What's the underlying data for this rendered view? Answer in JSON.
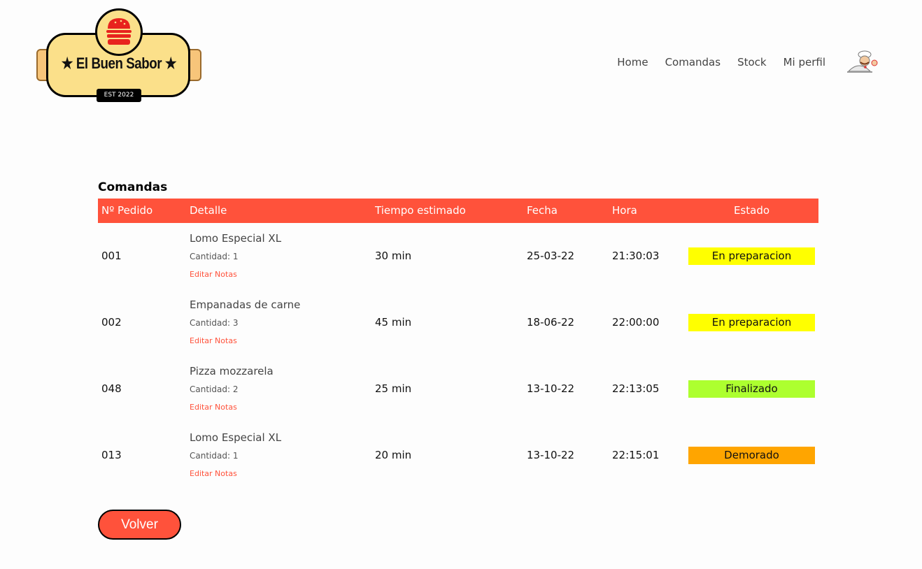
{
  "brand": {
    "name": "El Buen Sabor",
    "est": "EST 2022"
  },
  "nav": {
    "items": [
      "Home",
      "Comandas",
      "Stock",
      "Mi perfil"
    ]
  },
  "page": {
    "title": "Comandas"
  },
  "table": {
    "headers": [
      "Nº Pedido",
      "Detalle",
      "Tiempo estimado",
      "Fecha",
      "Hora",
      "Estado"
    ],
    "rows": [
      {
        "pedido": "001",
        "producto": "Lomo Especial XL",
        "cantidad": "Cantidad: 1",
        "notas": "Editar Notas",
        "tiempo": "30 min",
        "fecha": "25-03-22",
        "hora": "21:30:03",
        "estado": "En preparacion",
        "estado_color": "#ffff00"
      },
      {
        "pedido": "002",
        "producto": "Empanadas de carne",
        "cantidad": "Cantidad: 3",
        "notas": "Editar Notas",
        "tiempo": "45 min",
        "fecha": "18-06-22",
        "hora": "22:00:00",
        "estado": "En preparacion",
        "estado_color": "#ffff00"
      },
      {
        "pedido": "048",
        "producto": "Pizza mozzarela",
        "cantidad": "Cantidad: 2",
        "notas": "Editar Notas",
        "tiempo": "25 min",
        "fecha": "13-10-22",
        "hora": "22:13:05",
        "estado": "Finalizado",
        "estado_color": "#adff2f"
      },
      {
        "pedido": "013",
        "producto": "Lomo Especial XL",
        "cantidad": "Cantidad: 1",
        "notas": "Editar Notas",
        "tiempo": "20 min",
        "fecha": "13-10-22",
        "hora": "22:15:01",
        "estado": "Demorado",
        "estado_color": "#ffa500"
      }
    ]
  },
  "actions": {
    "back_label": "Volver"
  },
  "colors": {
    "accent": "#ff523b",
    "logo_yellow": "#fbe08a"
  }
}
